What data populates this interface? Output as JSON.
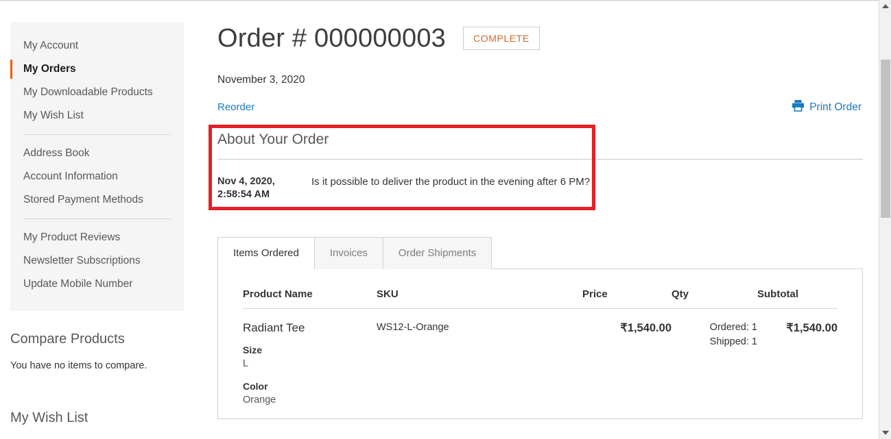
{
  "sidebar": {
    "groups": [
      {
        "items": [
          {
            "label": "My Account",
            "current": false
          },
          {
            "label": "My Orders",
            "current": true
          },
          {
            "label": "My Downloadable Products",
            "current": false
          },
          {
            "label": "My Wish List",
            "current": false
          }
        ]
      },
      {
        "items": [
          {
            "label": "Address Book",
            "current": false
          },
          {
            "label": "Account Information",
            "current": false
          },
          {
            "label": "Stored Payment Methods",
            "current": false
          }
        ]
      },
      {
        "items": [
          {
            "label": "My Product Reviews",
            "current": false
          },
          {
            "label": "Newsletter Subscriptions",
            "current": false
          },
          {
            "label": "Update Mobile Number",
            "current": false
          }
        ]
      }
    ],
    "compare_block": {
      "title": "Compare Products",
      "empty_text": "You have no items to compare."
    },
    "wishlist_block": {
      "title": "My Wish List"
    }
  },
  "order": {
    "title": "Order # 000000003",
    "status": "COMPLETE",
    "date": "November 3, 2020",
    "reorder_label": "Reorder",
    "print_label": "Print Order",
    "print_icon": "printer-icon"
  },
  "about": {
    "title": "About Your Order",
    "comments": [
      {
        "date": "Nov 4, 2020, 2:58:54 AM",
        "text": "Is it possible to deliver the product in the evening after 6 PM?"
      }
    ]
  },
  "tabs": [
    {
      "label": "Items Ordered",
      "active": true
    },
    {
      "label": "Invoices",
      "active": false
    },
    {
      "label": "Order Shipments",
      "active": false
    }
  ],
  "items_table": {
    "columns": [
      "Product Name",
      "SKU",
      "Price",
      "Qty",
      "Subtotal"
    ],
    "rows": [
      {
        "product_name": "Radiant Tee",
        "options": [
          {
            "label": "Size",
            "value": "L"
          },
          {
            "label": "Color",
            "value": "Orange"
          }
        ],
        "sku": "WS12-L-Orange",
        "price": "₹1,540.00",
        "qty_ordered": "Ordered: 1",
        "qty_shipped": "Shipped: 1",
        "subtotal": "₹1,540.00"
      }
    ]
  },
  "annotation": {
    "highlight_color": "#e41f26"
  }
}
